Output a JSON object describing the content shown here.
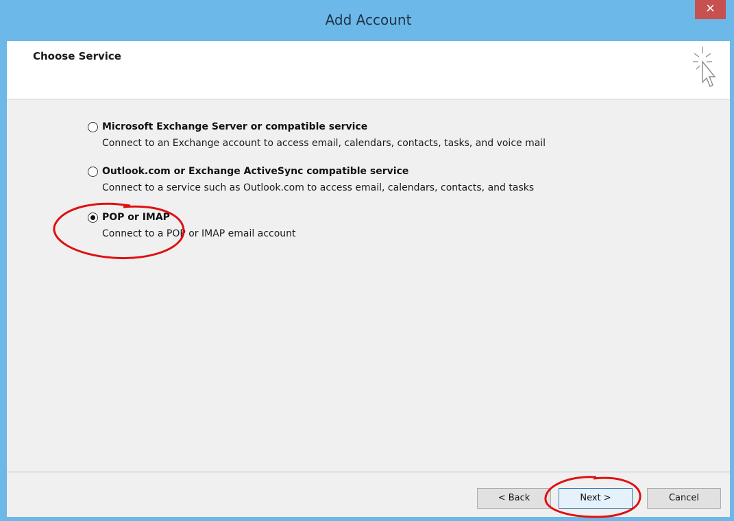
{
  "window": {
    "title": "Add Account",
    "close_glyph": "✕"
  },
  "header": {
    "title": "Choose Service",
    "icon": "wizard-cursor-icon"
  },
  "options": [
    {
      "label": "Microsoft Exchange Server or compatible service",
      "description": "Connect to an Exchange account to access email, calendars, contacts, tasks, and voice mail",
      "selected": false
    },
    {
      "label": "Outlook.com or Exchange ActiveSync compatible service",
      "description": "Connect to a service such as Outlook.com to access email, calendars, contacts, and tasks",
      "selected": false
    },
    {
      "label": "POP or IMAP",
      "description": "Connect to a POP or IMAP email account",
      "selected": true
    }
  ],
  "buttons": {
    "back": "< Back",
    "next": "Next >",
    "cancel": "Cancel"
  },
  "colors": {
    "titlebar": "#6cb8e8",
    "close": "#c75050",
    "annotation": "#e01010"
  }
}
